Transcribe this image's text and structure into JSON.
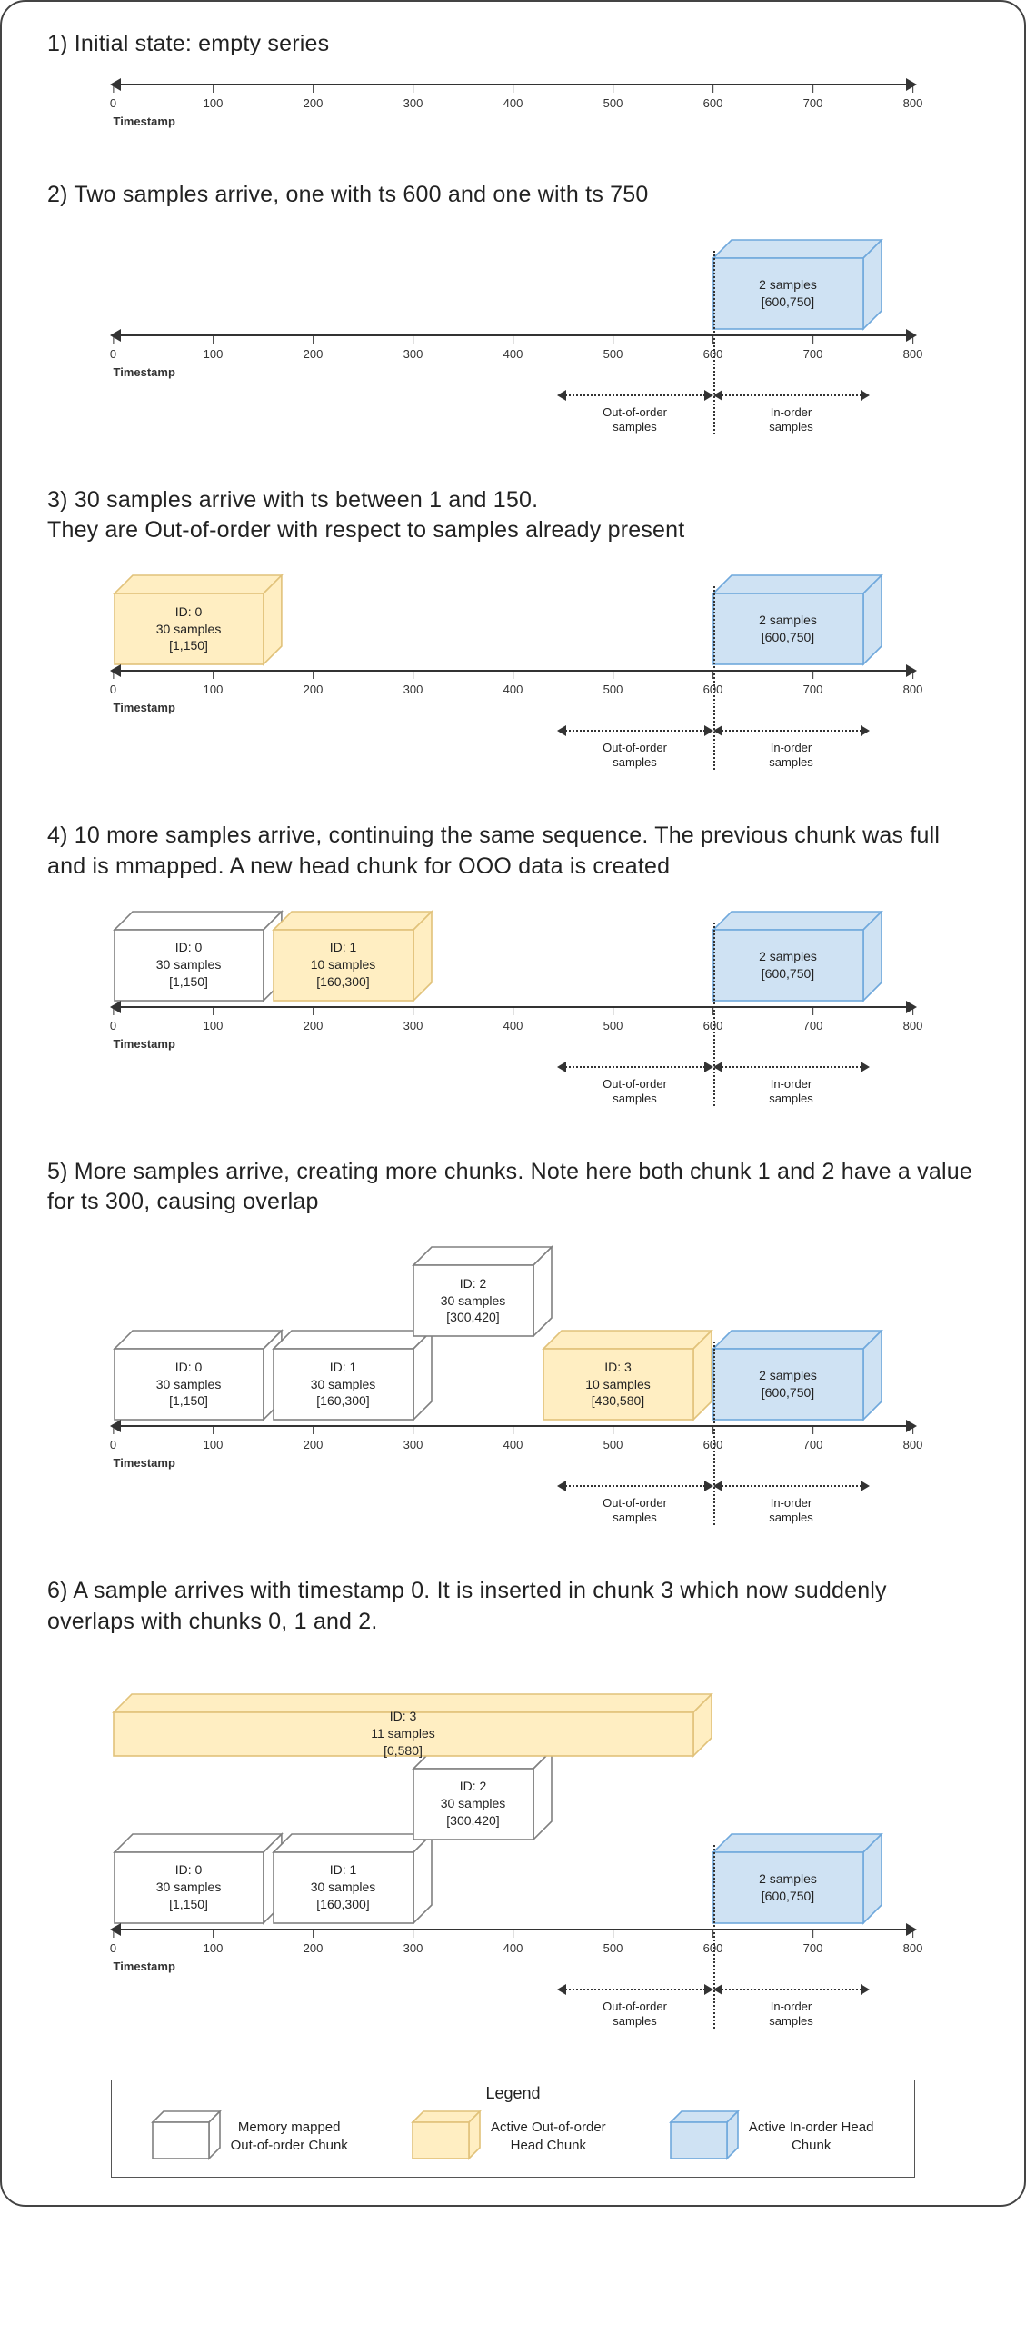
{
  "axis": {
    "label": "Timestamp",
    "ticks": [
      0,
      100,
      200,
      300,
      400,
      500,
      600,
      700,
      800
    ],
    "min": 0,
    "max": 800
  },
  "split": 600,
  "split_labels": {
    "left": "Out-of-order\nsamples",
    "right": "In-order\nsamples"
  },
  "colors": {
    "blue": "#cfe2f3",
    "yellow": "#ffeec2",
    "white": "#ffffff"
  },
  "steps": [
    {
      "id": 1,
      "title": "1) Initial state: empty series",
      "show_split": false,
      "chunks": [],
      "axis_width": 880
    },
    {
      "id": 2,
      "title": "2) Two samples arrive, one with ts 600 and one with ts 750",
      "show_split": true,
      "axis_width": 880,
      "chunks": [
        {
          "kind": "blue",
          "lines": [
            "2 samples",
            "[600,750]"
          ],
          "from": 600,
          "to": 750,
          "row": 0
        }
      ]
    },
    {
      "id": 3,
      "title": "3) 30 samples arrive with ts between 1 and 150.\nThey are Out-of-order with respect to samples already present",
      "show_split": true,
      "axis_width": 880,
      "chunks": [
        {
          "kind": "yellow",
          "lines": [
            "ID: 0",
            "30 samples",
            "[1,150]"
          ],
          "from": 1,
          "to": 150,
          "row": 0
        },
        {
          "kind": "blue",
          "lines": [
            "2 samples",
            "[600,750]"
          ],
          "from": 600,
          "to": 750,
          "row": 0
        }
      ]
    },
    {
      "id": 4,
      "title": "4) 10 more samples arrive, continuing the same sequence. The previous chunk was full and is mmapped. A new head chunk for OOO data is created",
      "show_split": true,
      "axis_width": 880,
      "chunks": [
        {
          "kind": "white",
          "lines": [
            "ID: 0",
            "30 samples",
            "[1,150]"
          ],
          "from": 1,
          "to": 150,
          "row": 0
        },
        {
          "kind": "yellow",
          "lines": [
            "ID: 1",
            "10 samples",
            "[160,300]"
          ],
          "from": 160,
          "to": 300,
          "row": 0
        },
        {
          "kind": "blue",
          "lines": [
            "2 samples",
            "[600,750]"
          ],
          "from": 600,
          "to": 750,
          "row": 0
        }
      ]
    },
    {
      "id": 5,
      "title": "5) More samples arrive, creating more chunks. Note here both chunk 1 and 2 have a value for ts 300, causing overlap",
      "show_split": true,
      "axis_width": 880,
      "chunks": [
        {
          "kind": "white",
          "lines": [
            "ID: 0",
            "30 samples",
            "[1,150]"
          ],
          "from": 1,
          "to": 150,
          "row": 0
        },
        {
          "kind": "white",
          "lines": [
            "ID: 1",
            "30 samples",
            "[160,300]"
          ],
          "from": 160,
          "to": 300,
          "row": 0
        },
        {
          "kind": "white",
          "lines": [
            "ID: 2",
            "30 samples",
            "[300,420]"
          ],
          "from": 300,
          "to": 420,
          "row": 1
        },
        {
          "kind": "yellow",
          "lines": [
            "ID: 3",
            "10 samples",
            "[430,580]"
          ],
          "from": 430,
          "to": 580,
          "row": 0
        },
        {
          "kind": "blue",
          "lines": [
            "2 samples",
            "[600,750]"
          ],
          "from": 600,
          "to": 750,
          "row": 0
        }
      ]
    },
    {
      "id": 6,
      "title": "6) A sample arrives with timestamp 0. It is inserted in chunk 3 which now suddenly overlaps with chunks 0, 1 and 2.",
      "show_split": true,
      "axis_width": 880,
      "chunks": [
        {
          "kind": "white",
          "lines": [
            "ID: 0",
            "30 samples",
            "[1,150]"
          ],
          "from": 1,
          "to": 150,
          "row": 0
        },
        {
          "kind": "white",
          "lines": [
            "ID: 1",
            "30 samples",
            "[160,300]"
          ],
          "from": 160,
          "to": 300,
          "row": 0
        },
        {
          "kind": "white",
          "lines": [
            "ID: 2",
            "30 samples",
            "[300,420]"
          ],
          "from": 300,
          "to": 420,
          "row": 1
        },
        {
          "kind": "yellow",
          "lines": [
            "ID: 3",
            "11 samples",
            "[0,580]"
          ],
          "from": 0,
          "to": 580,
          "row": 2,
          "thin": true
        },
        {
          "kind": "blue",
          "lines": [
            "2 samples",
            "[600,750]"
          ],
          "from": 600,
          "to": 750,
          "row": 0
        }
      ]
    }
  ],
  "legend": {
    "title": "Legend",
    "items": [
      {
        "kind": "white",
        "label": "Memory mapped\nOut-of-order Chunk"
      },
      {
        "kind": "yellow",
        "label": "Active Out-of-order\nHead Chunk"
      },
      {
        "kind": "blue",
        "label": "Active In-order Head\nChunk"
      }
    ]
  },
  "chart_data": {
    "type": "table",
    "title": "Out-of-order sample handling — chunk state per step",
    "axis": {
      "name": "Timestamp",
      "min": 0,
      "max": 800,
      "ticks": [
        0,
        100,
        200,
        300,
        400,
        500,
        600,
        700,
        800
      ],
      "in_order_boundary": 600
    },
    "series": [
      {
        "step": 1,
        "chunks": []
      },
      {
        "step": 2,
        "chunks": [
          {
            "id": null,
            "type": "in_order_head",
            "samples": 2,
            "range": [
              600,
              750
            ]
          }
        ]
      },
      {
        "step": 3,
        "chunks": [
          {
            "id": 0,
            "type": "ooo_head",
            "samples": 30,
            "range": [
              1,
              150
            ]
          },
          {
            "id": null,
            "type": "in_order_head",
            "samples": 2,
            "range": [
              600,
              750
            ]
          }
        ]
      },
      {
        "step": 4,
        "chunks": [
          {
            "id": 0,
            "type": "ooo_mmapped",
            "samples": 30,
            "range": [
              1,
              150
            ]
          },
          {
            "id": 1,
            "type": "ooo_head",
            "samples": 10,
            "range": [
              160,
              300
            ]
          },
          {
            "id": null,
            "type": "in_order_head",
            "samples": 2,
            "range": [
              600,
              750
            ]
          }
        ]
      },
      {
        "step": 5,
        "chunks": [
          {
            "id": 0,
            "type": "ooo_mmapped",
            "samples": 30,
            "range": [
              1,
              150
            ]
          },
          {
            "id": 1,
            "type": "ooo_mmapped",
            "samples": 30,
            "range": [
              160,
              300
            ]
          },
          {
            "id": 2,
            "type": "ooo_mmapped",
            "samples": 30,
            "range": [
              300,
              420
            ]
          },
          {
            "id": 3,
            "type": "ooo_head",
            "samples": 10,
            "range": [
              430,
              580
            ]
          },
          {
            "id": null,
            "type": "in_order_head",
            "samples": 2,
            "range": [
              600,
              750
            ]
          }
        ]
      },
      {
        "step": 6,
        "chunks": [
          {
            "id": 0,
            "type": "ooo_mmapped",
            "samples": 30,
            "range": [
              1,
              150
            ]
          },
          {
            "id": 1,
            "type": "ooo_mmapped",
            "samples": 30,
            "range": [
              160,
              300
            ]
          },
          {
            "id": 2,
            "type": "ooo_mmapped",
            "samples": 30,
            "range": [
              300,
              420
            ]
          },
          {
            "id": 3,
            "type": "ooo_head",
            "samples": 11,
            "range": [
              0,
              580
            ]
          },
          {
            "id": null,
            "type": "in_order_head",
            "samples": 2,
            "range": [
              600,
              750
            ]
          }
        ]
      }
    ]
  }
}
